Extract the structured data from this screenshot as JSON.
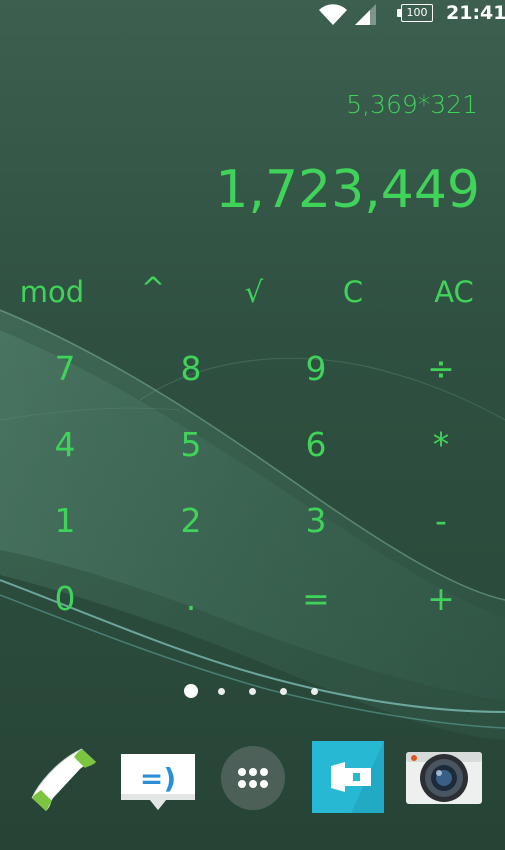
{
  "status_bar": {
    "battery": "100",
    "time": "21:41"
  },
  "calculator": {
    "expression": "5,369*321",
    "result": "1,723,449",
    "function_row": [
      "mod",
      "^",
      "√",
      "C",
      "AC"
    ],
    "rows": [
      [
        "7",
        "8",
        "9",
        "÷"
      ],
      [
        "4",
        "5",
        "6",
        "*"
      ],
      [
        "1",
        "2",
        "3",
        "-"
      ],
      [
        "0",
        ".",
        "=",
        "+"
      ]
    ],
    "text_color": "#3fd35a"
  },
  "home": {
    "page_count": 5,
    "active_page": 1
  },
  "dock": {
    "icons": [
      "phone-icon",
      "messaging-icon",
      "app-drawer-icon",
      "album-icon",
      "camera-icon"
    ]
  }
}
